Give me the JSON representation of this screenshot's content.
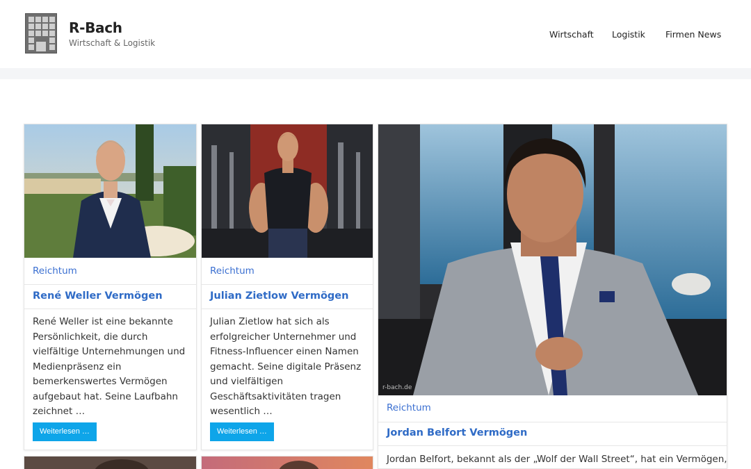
{
  "site": {
    "title": "R-Bach",
    "tagline": "Wirtschaft & Logistik"
  },
  "nav": {
    "items": [
      {
        "label": "Wirtschaft"
      },
      {
        "label": "Logistik"
      },
      {
        "label": "Firmen News"
      }
    ]
  },
  "posts": [
    {
      "category": "Reichtum",
      "title": "René Weller Vermögen",
      "excerpt": "René Weller ist eine bekannte Persönlichkeit, die durch vielfältige Unternehmungen und Medienpräsenz ein bemerkenswertes Vermögen aufgebaut hat. Seine Laufbahn zeichnet …",
      "button": "Weiterlesen …"
    },
    {
      "category": "Reichtum",
      "title": "Julian Zietlow Vermögen",
      "excerpt": "Julian Zietlow hat sich als erfolgreicher Unternehmer und Fitness-Influencer einen Namen gemacht. Seine digitale Präsenz und vielfältigen Geschäftsaktivitäten tragen wesentlich …",
      "button": "Weiterlesen …"
    },
    {
      "category": "Reichtum",
      "title": "Jordan Belfort Vermögen",
      "excerpt": "Jordan Belfort, bekannt als der „Wolf der Wall Street“, hat ein Vermögen,",
      "watermark": "r-bach.de"
    }
  ]
}
